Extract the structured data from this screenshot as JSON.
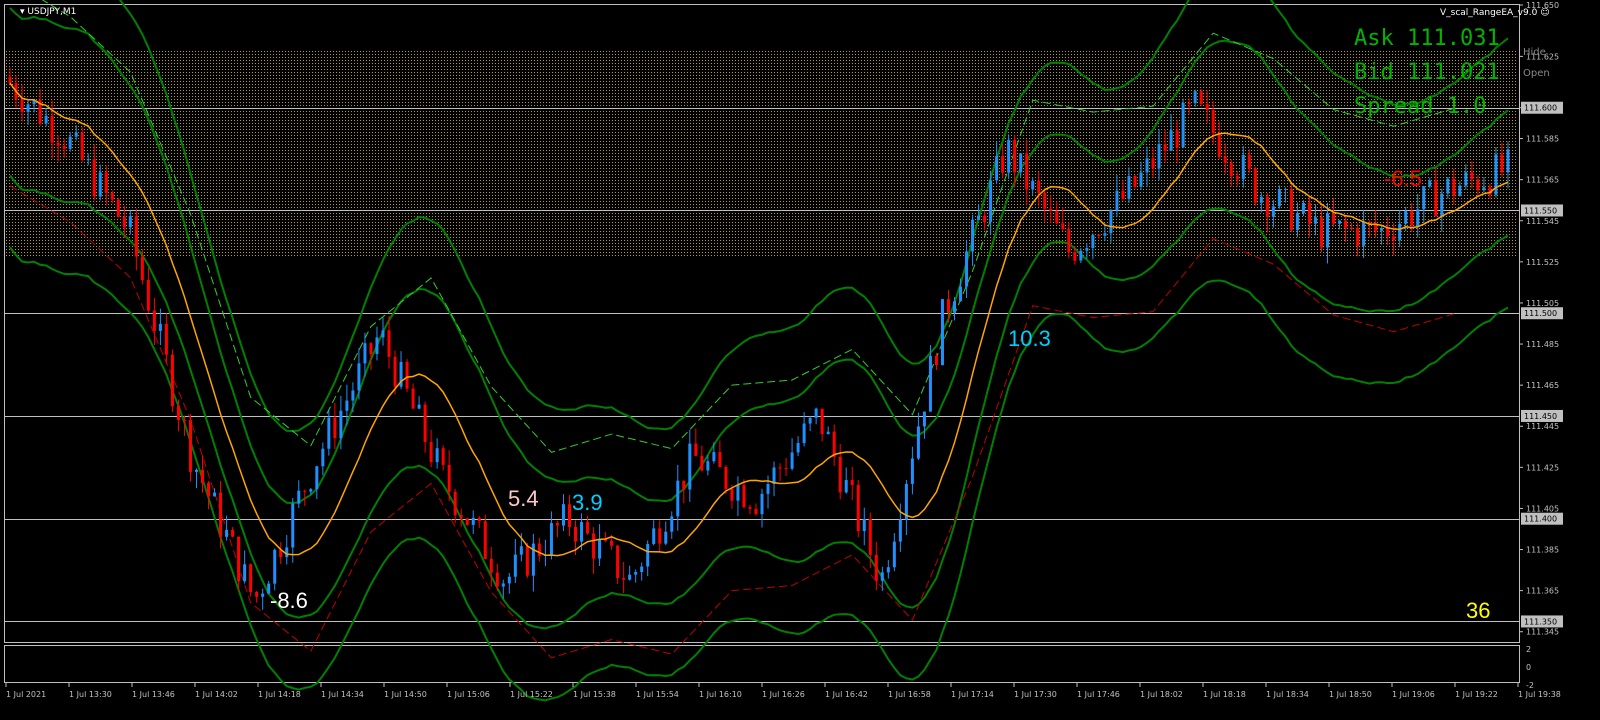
{
  "window": {
    "symbol": "USDJPY,M1",
    "expert": "V_scal_RangeEA_v9.0",
    "ask": "Ask 111.031",
    "bid": "Bid 111.021",
    "spread": "Spread 1.0",
    "hide_label": "Hide",
    "open_label": "Open",
    "counter": "36",
    "smiley_icon": "smiley-icon"
  },
  "trade_labels": [
    {
      "text": "-8.6",
      "color": "#ffffff"
    },
    {
      "text": "5.4",
      "color": "#ffc8c8"
    },
    {
      "text": "3.9",
      "color": "#00d0ff"
    },
    {
      "text": "10.3",
      "color": "#00d0ff"
    },
    {
      "text": "-6.5",
      "color": "#ff0000"
    }
  ],
  "price_axis": {
    "ticks": [
      "111.650",
      "111.625",
      "111.600",
      "111.585",
      "111.565",
      "111.545",
      "111.525",
      "111.505",
      "111.485",
      "111.465",
      "111.445",
      "111.425",
      "111.405",
      "111.385",
      "111.365",
      "111.345"
    ],
    "level_tags": [
      "111.600",
      "111.550",
      "111.500",
      "111.450",
      "111.400",
      "111.350"
    ]
  },
  "indicator_axis": {
    "ticks": [
      "2",
      "0",
      "-2"
    ]
  },
  "time_axis": {
    "ticks": [
      "1 Jul 2021",
      "1 Jul 13:30",
      "1 Jul 13:46",
      "1 Jul 14:02",
      "1 Jul 14:18",
      "1 Jul 14:34",
      "1 Jul 14:50",
      "1 Jul 15:06",
      "1 Jul 15:22",
      "1 Jul 15:38",
      "1 Jul 15:54",
      "1 Jul 16:10",
      "1 Jul 16:26",
      "1 Jul 16:42",
      "1 Jul 16:58",
      "1 Jul 17:14",
      "1 Jul 17:30",
      "1 Jul 17:46",
      "1 Jul 18:02",
      "1 Jul 18:18",
      "1 Jul 18:34",
      "1 Jul 18:50",
      "1 Jul 19:06",
      "1 Jul 19:22",
      "1 Jul 19:38"
    ]
  },
  "colors": {
    "bull": "#1e90ff",
    "bear": "#ff0000",
    "ma": "#ffa500",
    "band": "#008000",
    "zone": "#b8a000",
    "accent_text": "#00b400",
    "counter": "#ffff00"
  },
  "chart_data": {
    "type": "candlestick",
    "symbol": "USDJPY",
    "timeframe": "M1",
    "ylim": [
      111.34,
      111.65
    ],
    "horizontal_levels": [
      111.6,
      111.55,
      111.5,
      111.45,
      111.4,
      111.35
    ],
    "close_path": [
      {
        "t": "1 Jul 2021",
        "v": 111.615
      },
      {
        "t": "1 Jul 13:30",
        "v": 111.585
      },
      {
        "t": "1 Jul 13:46",
        "v": 111.54
      },
      {
        "t": "1 Jul 14:02",
        "v": 111.43
      },
      {
        "t": "1 Jul 14:18",
        "v": 111.36
      },
      {
        "t": "1 Jul 14:34",
        "v": 111.43
      },
      {
        "t": "1 Jul 14:50",
        "v": 111.49
      },
      {
        "t": "1 Jul 15:06",
        "v": 111.42
      },
      {
        "t": "1 Jul 15:22",
        "v": 111.37
      },
      {
        "t": "1 Jul 15:38",
        "v": 111.4
      },
      {
        "t": "1 Jul 15:54",
        "v": 111.37
      },
      {
        "t": "1 Jul 16:10",
        "v": 111.43
      },
      {
        "t": "1 Jul 16:26",
        "v": 111.41
      },
      {
        "t": "1 Jul 16:42",
        "v": 111.45
      },
      {
        "t": "1 Jul 16:58",
        "v": 111.37
      },
      {
        "t": "1 Jul 17:14",
        "v": 111.5
      },
      {
        "t": "1 Jul 17:30",
        "v": 111.58
      },
      {
        "t": "1 Jul 17:46",
        "v": 111.53
      },
      {
        "t": "1 Jul 18:02",
        "v": 111.56
      },
      {
        "t": "1 Jul 18:18",
        "v": 111.6
      },
      {
        "t": "1 Jul 18:34",
        "v": 111.56
      },
      {
        "t": "1 Jul 18:50",
        "v": 111.54
      },
      {
        "t": "1 Jul 19:06",
        "v": 111.54
      },
      {
        "t": "1 Jul 19:22",
        "v": 111.56
      },
      {
        "t": "1 Jul 19:38",
        "v": 111.57
      }
    ]
  }
}
